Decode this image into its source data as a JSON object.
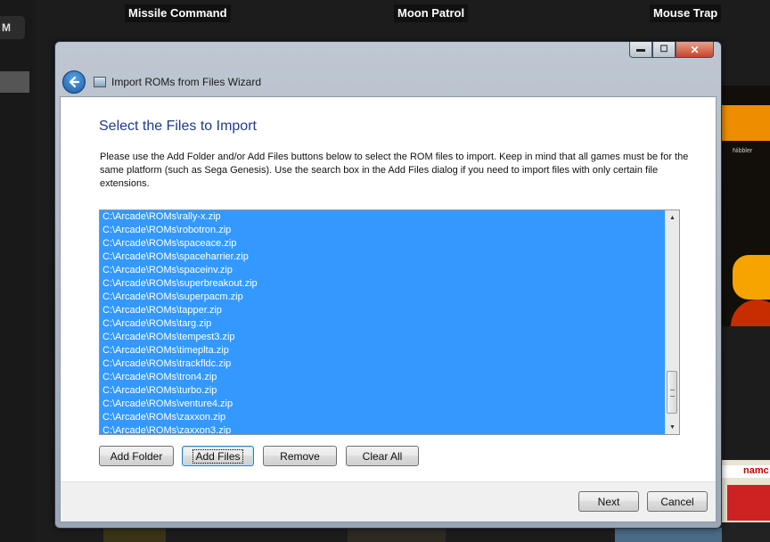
{
  "background": {
    "game_titles": [
      "Missile Command",
      "Moon Patrol",
      "Mouse Trap"
    ],
    "menu_letter": "M",
    "art_text": "Nibbler",
    "art_band_text": "namc"
  },
  "window": {
    "title": "Import ROMs from Files Wizard",
    "controls": {
      "minimize": "▬",
      "maximize": "☐",
      "close": "✕"
    },
    "back_icon": "arrow-left-icon"
  },
  "wizard": {
    "heading": "Select the Files to Import",
    "description": "Please use the Add Folder and/or Add Files buttons below to select the ROM files to import. Keep in mind that all games must be for the same platform (such as Sega Genesis). Use the search box in the Add Files dialog if you need to import files with only certain file extensions.",
    "files": [
      "C:\\Arcade\\ROMs\\rally-x.zip",
      "C:\\Arcade\\ROMs\\robotron.zip",
      "C:\\Arcade\\ROMs\\spaceace.zip",
      "C:\\Arcade\\ROMs\\spaceharrier.zip",
      "C:\\Arcade\\ROMs\\spaceinv.zip",
      "C:\\Arcade\\ROMs\\superbreakout.zip",
      "C:\\Arcade\\ROMs\\superpacm.zip",
      "C:\\Arcade\\ROMs\\tapper.zip",
      "C:\\Arcade\\ROMs\\targ.zip",
      "C:\\Arcade\\ROMs\\tempest3.zip",
      "C:\\Arcade\\ROMs\\timeplta.zip",
      "C:\\Arcade\\ROMs\\trackfldc.zip",
      "C:\\Arcade\\ROMs\\tron4.zip",
      "C:\\Arcade\\ROMs\\turbo.zip",
      "C:\\Arcade\\ROMs\\venture4.zip",
      "C:\\Arcade\\ROMs\\zaxxon.zip",
      "C:\\Arcade\\ROMs\\zaxxon3.zip"
    ],
    "selection_color": "#3399ff",
    "buttons": {
      "add_folder": "Add Folder",
      "add_files": "Add Files",
      "remove": "Remove",
      "clear_all": "Clear All"
    },
    "footer": {
      "next": "Next",
      "cancel": "Cancel"
    }
  }
}
